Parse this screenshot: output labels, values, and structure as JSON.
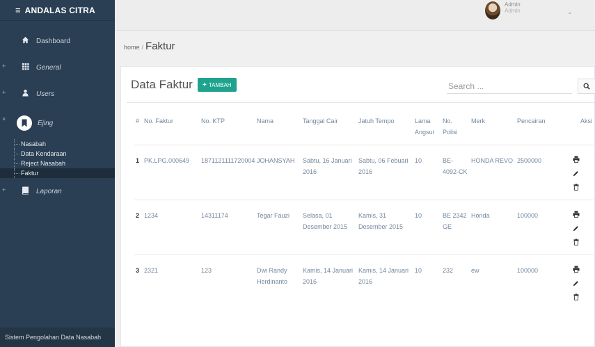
{
  "app": {
    "brand": "ANDALAS CITRA",
    "menu_glyph": "≡"
  },
  "sidebar": {
    "items": [
      {
        "label": "Dashboard",
        "icon": "home-icon"
      },
      {
        "label": "General",
        "icon": "grid-icon"
      },
      {
        "label": "Users",
        "icon": "user-icon"
      },
      {
        "label": "Ejing",
        "icon": "bookmark-icon"
      },
      {
        "label": "Laporan",
        "icon": "book-icon"
      }
    ],
    "submenu": [
      "Nasabah",
      "Data Kendaraan",
      "Reject Nasabah",
      "Faktur"
    ],
    "footer": "Sistem Pengolahan Data Nasabah"
  },
  "topbar": {
    "user_name": "Admin",
    "user_role": "Admin",
    "caret": "⌄"
  },
  "breadcrumb": {
    "home": "home",
    "separator": "/",
    "current": "Faktur"
  },
  "panel": {
    "title": "Data Faktur",
    "add_button": "TAMBAH",
    "add_plus": "+",
    "search_placeholder": "Search ..."
  },
  "table": {
    "headers": [
      "#",
      "No. Faktur",
      "No. KTP",
      "Nama",
      "Tanggal Cair",
      "Jatuh Tempo",
      "Lama Angsur",
      "No. Polisi",
      "Merk",
      "Pencairan",
      "Aksi"
    ],
    "rows": [
      [
        "1",
        "PK.LPG.000649",
        "1871121111720004",
        "JOHANSYAH",
        "Sabtu, 16 Januari 2016",
        "Sabtu, 06 Febuari 2016",
        "10",
        "BE-4092-CK",
        "HONDA REVO",
        "2500000"
      ],
      [
        "2",
        "1234",
        "14311174",
        "Tegar Fauzi",
        "Selasa, 01 Desember 2015",
        "Kamis, 31 Desember 2015",
        "10",
        "BE 2342 GE",
        "Honda",
        "100000"
      ],
      [
        "3",
        "2321",
        "123",
        "Dwi Randy Herdinanto",
        "Kamis, 14 Januari 2016",
        "Kamis, 14 Januari 2016",
        "10",
        "232",
        "ew",
        "100000"
      ]
    ]
  },
  "colors": {
    "sidebar": "#2a3f54",
    "accent": "#1fa38e",
    "text": "#73879c"
  }
}
